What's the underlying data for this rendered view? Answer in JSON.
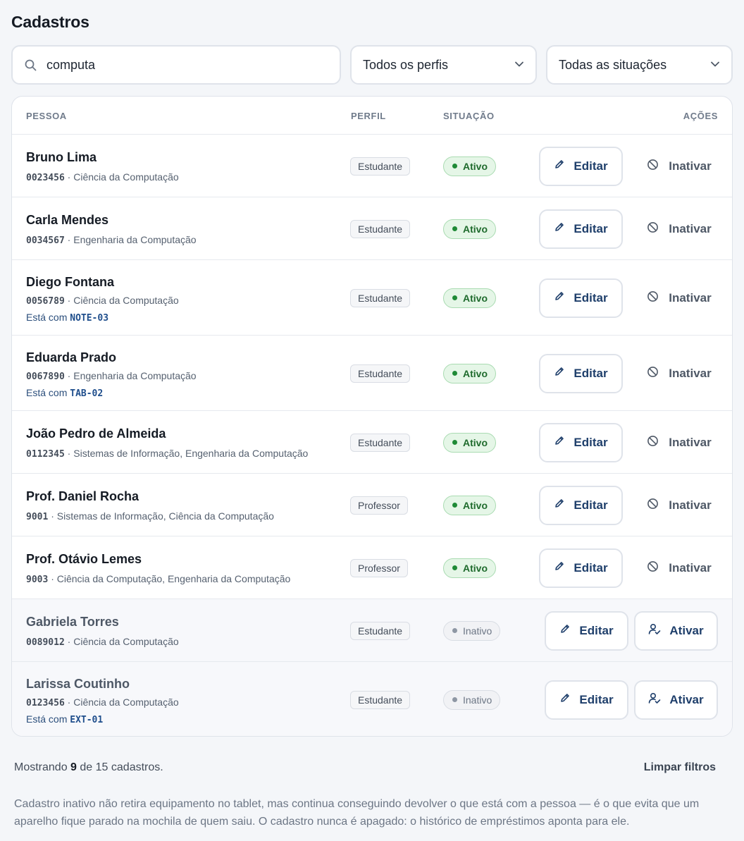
{
  "page": {
    "title": "Cadastros"
  },
  "filters": {
    "search_value": "computa",
    "profile_select": "Todos os perfis",
    "status_select": "Todas as situações"
  },
  "table": {
    "headers": {
      "person": "PESSOA",
      "profile": "PERFIL",
      "status": "SITUAÇÃO",
      "actions": "AÇÕES"
    },
    "rows": [
      {
        "name": "Bruno Lima",
        "code": "0023456",
        "courses": "Ciência da Computação",
        "with_label": "",
        "with_code": "",
        "profile": "Estudante",
        "status": "Ativo",
        "active": true,
        "edit": "Editar",
        "toggle": "Inativar"
      },
      {
        "name": "Carla Mendes",
        "code": "0034567",
        "courses": "Engenharia da Computação",
        "with_label": "",
        "with_code": "",
        "profile": "Estudante",
        "status": "Ativo",
        "active": true,
        "edit": "Editar",
        "toggle": "Inativar"
      },
      {
        "name": "Diego Fontana",
        "code": "0056789",
        "courses": "Ciência da Computação",
        "with_label": "Está com",
        "with_code": "NOTE-03",
        "profile": "Estudante",
        "status": "Ativo",
        "active": true,
        "edit": "Editar",
        "toggle": "Inativar"
      },
      {
        "name": "Eduarda Prado",
        "code": "0067890",
        "courses": "Engenharia da Computação",
        "with_label": "Está com",
        "with_code": "TAB-02",
        "profile": "Estudante",
        "status": "Ativo",
        "active": true,
        "edit": "Editar",
        "toggle": "Inativar"
      },
      {
        "name": "João Pedro de Almeida",
        "code": "0112345",
        "courses": "Sistemas de Informação, Engenharia da Computação",
        "with_label": "",
        "with_code": "",
        "profile": "Estudante",
        "status": "Ativo",
        "active": true,
        "edit": "Editar",
        "toggle": "Inativar"
      },
      {
        "name": "Prof. Daniel Rocha",
        "code": "9001",
        "courses": "Sistemas de Informação, Ciência da Computação",
        "with_label": "",
        "with_code": "",
        "profile": "Professor",
        "status": "Ativo",
        "active": true,
        "edit": "Editar",
        "toggle": "Inativar"
      },
      {
        "name": "Prof. Otávio Lemes",
        "code": "9003",
        "courses": "Ciência da Computação, Engenharia da Computação",
        "with_label": "",
        "with_code": "",
        "profile": "Professor",
        "status": "Ativo",
        "active": true,
        "edit": "Editar",
        "toggle": "Inativar"
      },
      {
        "name": "Gabriela Torres",
        "code": "0089012",
        "courses": "Ciência da Computação",
        "with_label": "",
        "with_code": "",
        "profile": "Estudante",
        "status": "Inativo",
        "active": false,
        "edit": "Editar",
        "toggle": "Ativar"
      },
      {
        "name": "Larissa Coutinho",
        "code": "0123456",
        "courses": "Ciência da Computação",
        "with_label": "Está com",
        "with_code": "EXT-01",
        "profile": "Estudante",
        "status": "Inativo",
        "active": false,
        "edit": "Editar",
        "toggle": "Ativar"
      }
    ]
  },
  "footer": {
    "showing_prefix": "Mostrando",
    "showing_count": "9",
    "showing_suffix": "de 15 cadastros.",
    "clear_filters": "Limpar filtros",
    "note": "Cadastro inativo não retira equipamento no tablet, mas continua conseguindo devolver o que está com a pessoa — é o que evita que um aparelho fique parado na mochila de quem saiu. O cadastro nunca é apagado: o histórico de empréstimos aponta para ele."
  },
  "colors": {
    "background": "#f4f6f9",
    "active_badge": "#e5f6e7",
    "active_text": "#1f6b2d",
    "button_text": "#1f3f6b"
  }
}
